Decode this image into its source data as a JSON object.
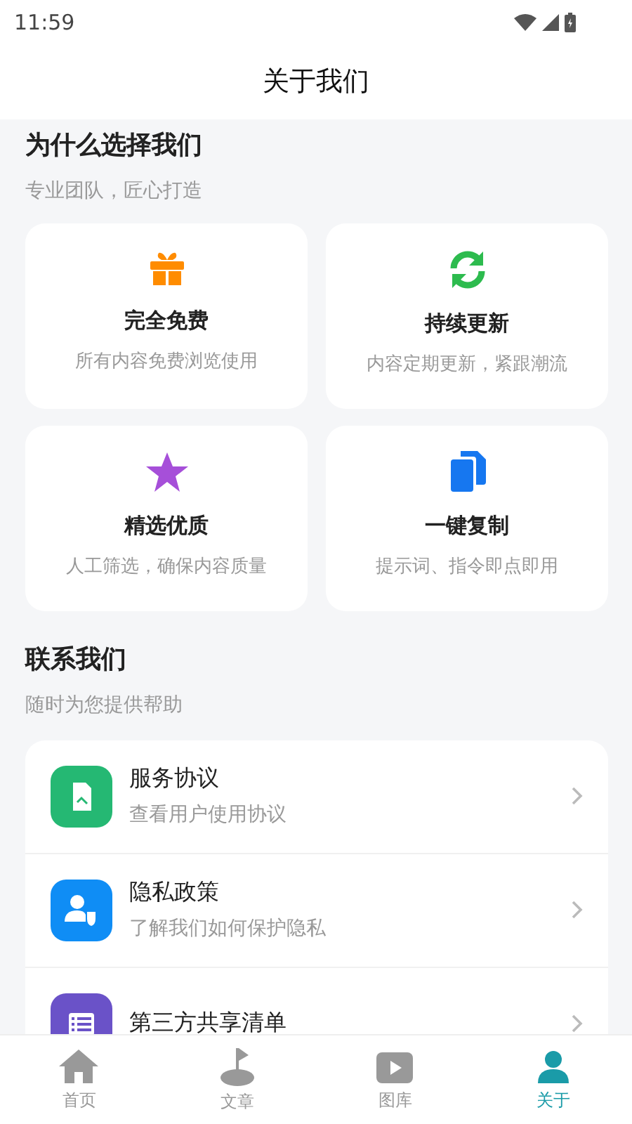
{
  "status_bar": {
    "time": "11:59"
  },
  "header": {
    "title": "关于我们"
  },
  "features": {
    "title": "为什么选择我们",
    "subtitle": "专业团队，匠心打造",
    "cards": [
      {
        "title": "完全免费",
        "text": "所有内容免费浏览使用"
      },
      {
        "title": "持续更新",
        "text": "内容定期更新，紧跟潮流"
      },
      {
        "title": "精选优质",
        "text": "人工筛选，确保内容质量"
      },
      {
        "title": "一键复制",
        "text": "提示词、指令即点即用"
      }
    ]
  },
  "contact": {
    "title": "联系我们",
    "subtitle": "随时为您提供帮助",
    "items": [
      {
        "title": "服务协议",
        "text": "查看用户使用协议"
      },
      {
        "title": "隐私政策",
        "text": "了解我们如何保护隐私"
      },
      {
        "title": "第三方共享清单"
      }
    ]
  },
  "tab_bar": [
    {
      "label": "首页",
      "selected": false
    },
    {
      "label": "文章",
      "selected": false
    },
    {
      "label": "图库",
      "selected": false
    },
    {
      "label": "关于",
      "selected": true
    }
  ]
}
